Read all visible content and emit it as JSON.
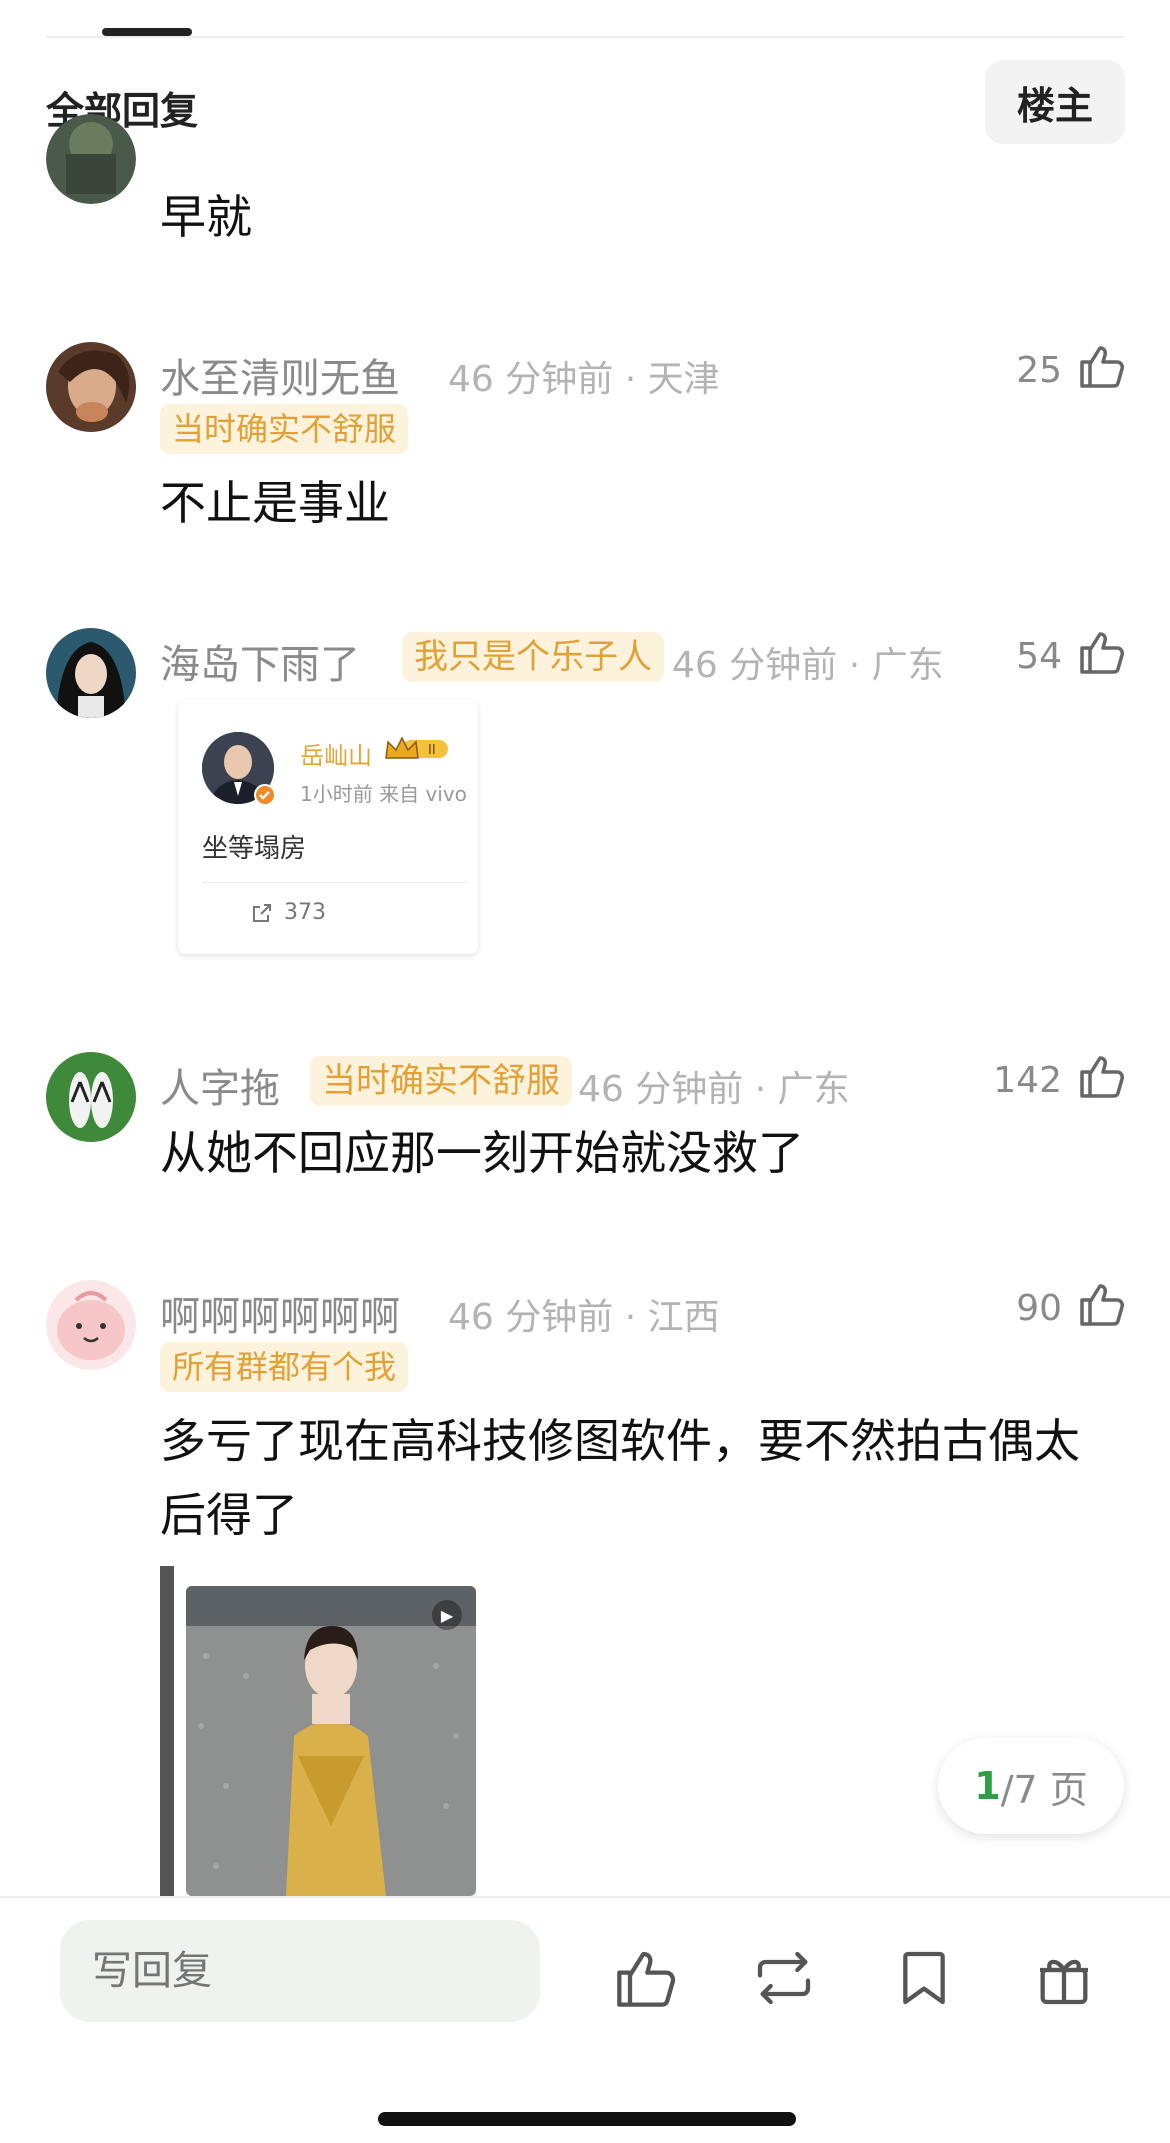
{
  "header": {
    "title": "全部回复",
    "op_label": "楼主"
  },
  "comments": [
    {
      "text": "早就"
    },
    {
      "username": "水至清则无鱼",
      "meta": "46 分钟前 · 天津",
      "tag": "当时确实不舒服",
      "likes": "25",
      "text": "不止是事业"
    },
    {
      "username": "海岛下雨了",
      "tag": "我只是个乐子人",
      "meta": "46 分钟前 · 广东",
      "likes": "54",
      "embed": {
        "name": "岳屾山",
        "time": "1小时前  来自 vivo",
        "text": "坐等塌房",
        "shares": "373"
      }
    },
    {
      "username": "人字拖",
      "tag": "当时确实不舒服",
      "meta": "46 分钟前 · 广东",
      "likes": "142",
      "text": "从她不回应那一刻开始就没救了"
    },
    {
      "username": "啊啊啊啊啊啊",
      "meta": "46 分钟前 · 江西",
      "tag": "所有群都有个我",
      "likes": "90",
      "text": "多亏了现在高科技修图软件，要不然拍古偶太后得了"
    }
  ],
  "pagination": {
    "current": "1",
    "total_text": "/7 页"
  },
  "bottom_bar": {
    "reply_placeholder": "写回复"
  },
  "colors": {
    "accent_green": "#2f9e44",
    "tag_text": "#e1a136",
    "tag_bg": "#fdf3dc",
    "meta_gray": "#b3b3b3"
  },
  "icons": [
    "thumb-up-icon",
    "repost-icon",
    "bookmark-icon",
    "gift-icon",
    "share-icon",
    "play-icon",
    "crown-badge-icon"
  ]
}
